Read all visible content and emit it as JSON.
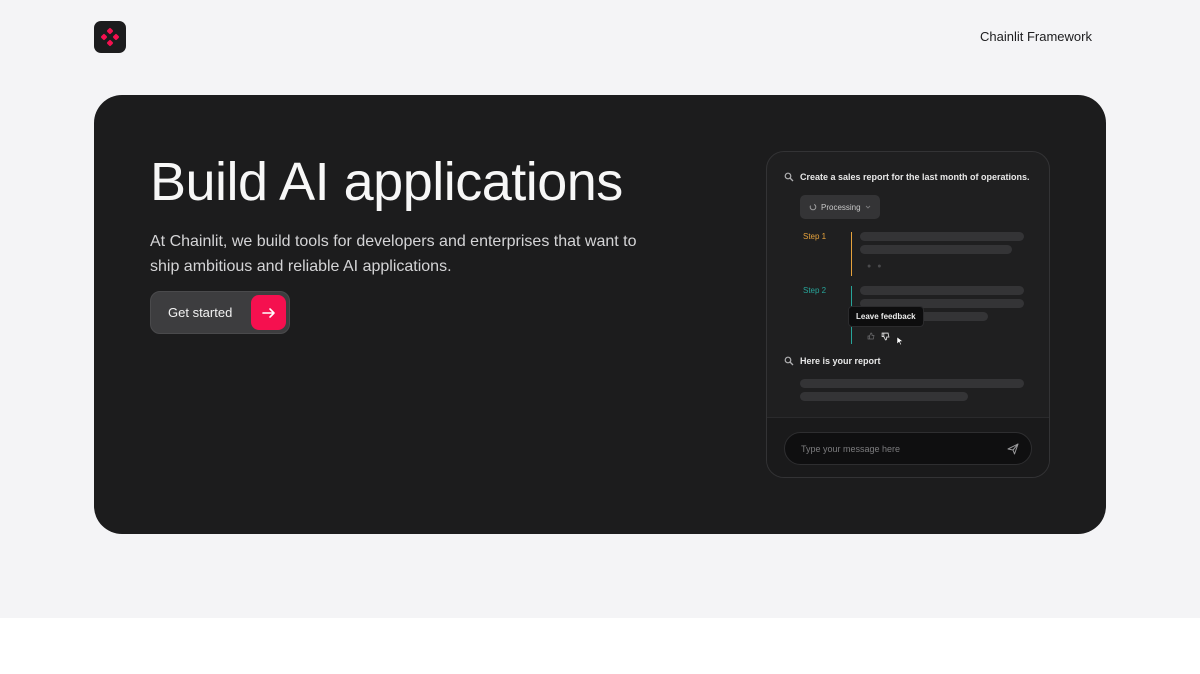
{
  "header": {
    "logo_icon": "chainlit-logo-icon",
    "nav_link": "Chainlit Framework"
  },
  "hero": {
    "title": "Build AI applications",
    "subtitle": "At Chainlit, we build tools for developers and enterprises that want to ship ambitious and reliable AI applications.",
    "cta_label": "Get started",
    "cta_icon": "arrow-right-icon"
  },
  "mockup": {
    "user_message": "Create a sales report for the last month of operations.",
    "status_chip": "Processing",
    "steps": [
      {
        "label": "Step 1",
        "color": "#e6a23c"
      },
      {
        "label": "Step 2",
        "color": "#27a59a"
      }
    ],
    "tooltip": "Leave feedback",
    "assistant_message": "Here is your report",
    "input_placeholder": "Type your message here"
  },
  "colors": {
    "accent": "#f5104f",
    "page_bg": "#f4f4f6",
    "hero_bg": "#1c1c1d"
  }
}
